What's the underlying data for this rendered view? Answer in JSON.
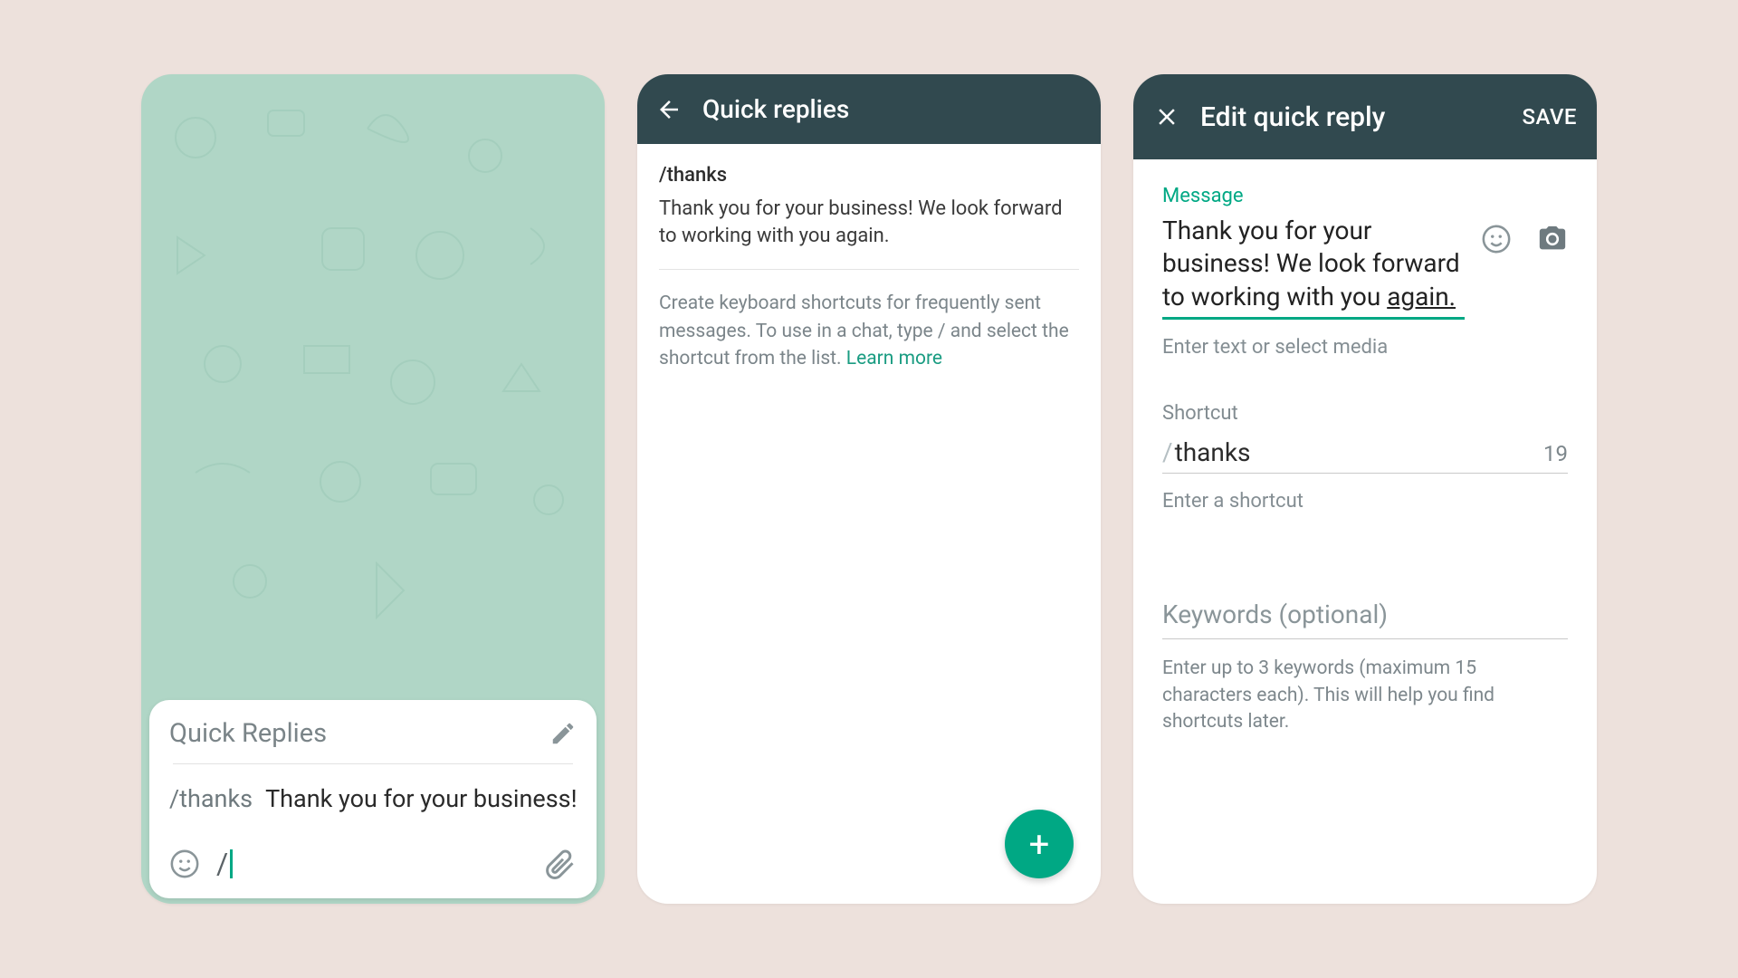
{
  "screen1": {
    "popup_title": "Quick Replies",
    "item": {
      "shortcut": "/thanks",
      "preview": "Thank you for your business! We …"
    },
    "input_value": "/"
  },
  "screen2": {
    "title": "Quick replies",
    "item": {
      "shortcut": "/thanks",
      "message": "Thank you for your business! We look forward to working with you again."
    },
    "help_text": "Create keyboard shortcuts for frequently sent messages. To use in a chat, type / and select the shortcut from the list. ",
    "learn_more": "Learn more",
    "fab_label": "+"
  },
  "screen3": {
    "title": "Edit quick reply",
    "save_label": "SAVE",
    "message_label": "Message",
    "message_part1": "Thank you for your business! We look forward to working with you ",
    "message_underlined": "again.",
    "message_hint": "Enter text or select media",
    "shortcut_label": "Shortcut",
    "shortcut_slash": "/",
    "shortcut_value": "thanks",
    "shortcut_count": "19",
    "shortcut_hint": "Enter a shortcut",
    "keywords_placeholder": "Keywords (optional)",
    "keywords_hint": "Enter up to 3 keywords (maximum 15 characters each). This will help you find shortcuts later."
  }
}
